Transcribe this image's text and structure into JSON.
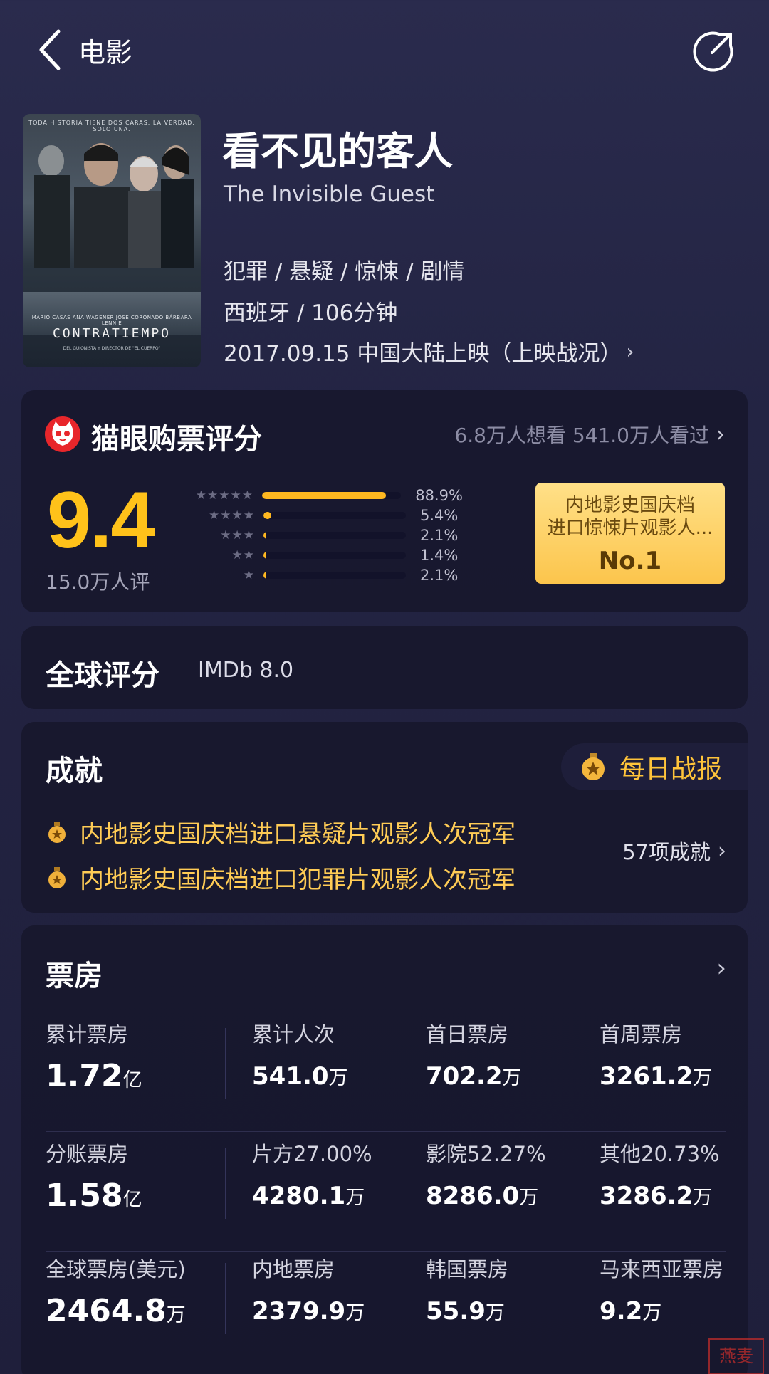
{
  "topbar": {
    "back_label": "电影"
  },
  "poster": {
    "tagline": "TODA HISTORIA TIENE DOS CARAS. LA VERDAD, SOLO UNA.",
    "credits": "MARIO CASAS   ANA WAGENER   JOSE CORONADO   BÁRBARA LENNIE",
    "title": "CONTRATIEMPO",
    "sub": "DEL GUIONISTA Y DIRECTOR DE \"EL CUERPO\""
  },
  "movie": {
    "title": "看不见的客人",
    "title_en": "The Invisible Guest",
    "genres": "犯罪 / 悬疑 / 惊悚 / 剧情",
    "meta": "西班牙 / 106分钟",
    "release": "2017.09.15 中国大陆上映（上映战况）"
  },
  "rating": {
    "title": "猫眼购票评分",
    "stats": "6.8万人想看 541.0万人看过",
    "score": "9.4",
    "count": "15.0万人评",
    "distribution": [
      {
        "stars": "★★★★★",
        "pct": "88.9%",
        "value": 88.9
      },
      {
        "stars": "★★★★",
        "pct": "5.4%",
        "value": 5.4
      },
      {
        "stars": "★★★",
        "pct": "2.1%",
        "value": 2.1
      },
      {
        "stars": "★★",
        "pct": "1.4%",
        "value": 1.4
      },
      {
        "stars": "★",
        "pct": "2.1%",
        "value": 2.1
      }
    ],
    "rank": {
      "line1": "内地影史国庆档",
      "line2": "进口惊悚片观影人...",
      "no": "No.1"
    }
  },
  "global": {
    "label": "全球评分",
    "value": "IMDb 8.0"
  },
  "achieve": {
    "title": "成就",
    "daily": "每日战报",
    "items": [
      "内地影史国庆档进口悬疑片观影人次冠军",
      "内地影史国庆档进口犯罪片观影人次冠军"
    ],
    "more": "57项成就"
  },
  "boxoffice": {
    "title": "票房",
    "rows": [
      [
        {
          "label": "累计票房",
          "value": "1.72",
          "unit": "亿"
        },
        {
          "label": "累计人次",
          "value": "541.0",
          "unit": "万"
        },
        {
          "label": "首日票房",
          "value": "702.2",
          "unit": "万"
        },
        {
          "label": "首周票房",
          "value": "3261.2",
          "unit": "万"
        }
      ],
      [
        {
          "label": "分账票房",
          "value": "1.58",
          "unit": "亿"
        },
        {
          "label": "片方27.00%",
          "value": "4280.1",
          "unit": "万"
        },
        {
          "label": "影院52.27%",
          "value": "8286.0",
          "unit": "万"
        },
        {
          "label": "其他20.73%",
          "value": "3286.2",
          "unit": "万"
        }
      ],
      [
        {
          "label": "全球票房(美元)",
          "value": "2464.8",
          "unit": "万"
        },
        {
          "label": "内地票房",
          "value": "2379.9",
          "unit": "万"
        },
        {
          "label": "韩国票房",
          "value": "55.9",
          "unit": "万"
        },
        {
          "label": "马来西亚票房",
          "value": "9.2",
          "unit": "万"
        }
      ]
    ]
  },
  "stamp": "燕麦",
  "colors": {
    "accent": "#ffc21a",
    "achievement": "#ffcc55",
    "background": "#232443"
  }
}
